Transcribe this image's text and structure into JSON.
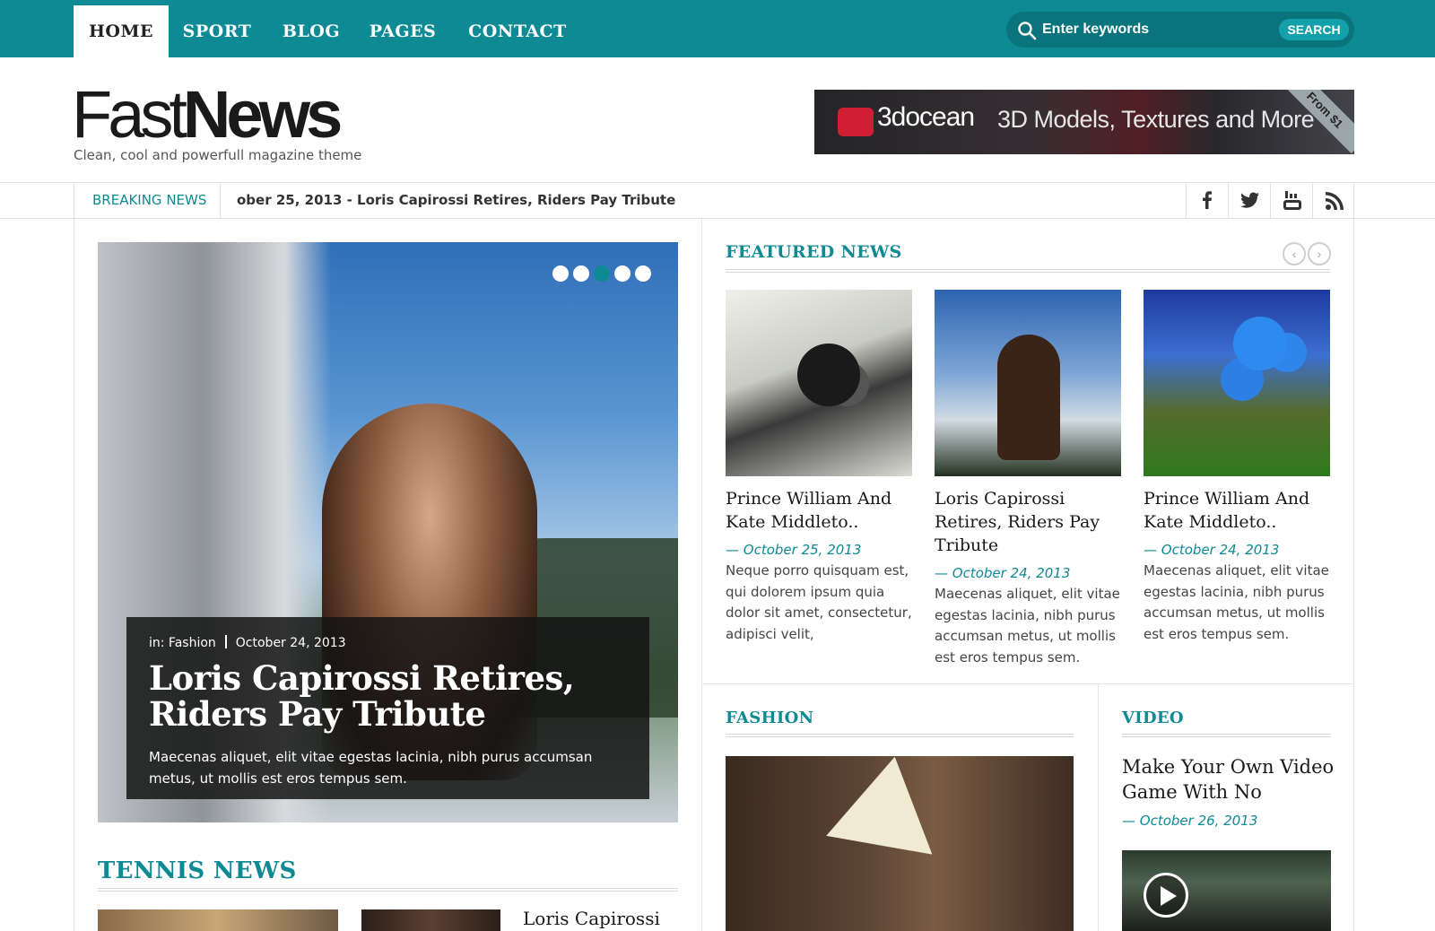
{
  "nav": {
    "items": [
      "HOME",
      "SPORT",
      "BLOG",
      "PAGES",
      "CONTACT"
    ],
    "active": "HOME",
    "search_placeholder": "Enter keywords",
    "search_button": "SEARCH"
  },
  "header": {
    "logo_thin": "Fast",
    "logo_bold": "News",
    "tagline": "Clean, cool  and powerfull  magazine theme",
    "banner": {
      "brand": "3docean",
      "text": "3D Models, Textures and More",
      "ribbon": "From $1"
    }
  },
  "breaking": {
    "label": "BREAKING NEWS",
    "text": "ober 25, 2013 - Loris Capirossi Retires, Riders Pay Tribute",
    "social": [
      "facebook-icon",
      "twitter-icon",
      "youtube-icon",
      "rss-icon"
    ]
  },
  "slider": {
    "dots": 5,
    "active_dot": 3,
    "category": "in: Fashion",
    "date": "October 24, 2013",
    "title": "Loris Capirossi Retires, Riders Pay Tribute",
    "description": "Maecenas aliquet, elit vitae egestas lacinia, nibh purus accumsan metus, ut mollis est eros tempus sem."
  },
  "featured": {
    "title": "FEATURED NEWS",
    "items": [
      {
        "title": "Prince William And Kate Middleto..",
        "date": "— October 25, 2013",
        "desc": "Neque porro quisquam est, qui dolorem ipsum quia dolor sit amet, consectetur, adipisci velit,"
      },
      {
        "title": "Loris Capirossi Retires, Riders Pay Tribute",
        "date": "— October 24, 2013",
        "desc": "Maecenas aliquet, elit vitae egestas lacinia, nibh purus accumsan metus, ut mollis est eros tempus sem."
      },
      {
        "title": "Prince William And Kate Middleto..",
        "date": "— October 24, 2013",
        "desc": "Maecenas aliquet, elit vitae egestas lacinia, nibh purus accumsan metus, ut mollis est eros tempus sem."
      }
    ]
  },
  "fashion": {
    "title": "FASHION"
  },
  "video": {
    "title": "VIDEO",
    "post_title": "Make Your Own Video Game With No",
    "date": "— October 26, 2013"
  },
  "tennis": {
    "title": "TENNIS NEWS",
    "post_title": "Loris Capirossi"
  },
  "colors": {
    "accent": "#0e8a95",
    "text": "#1a1a1a"
  }
}
